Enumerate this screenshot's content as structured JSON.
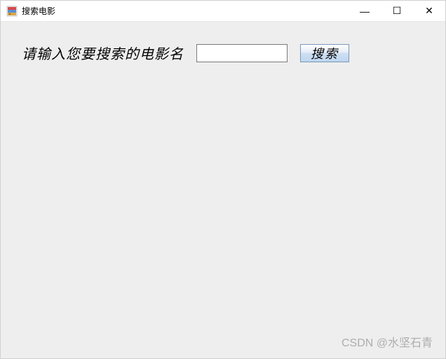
{
  "window": {
    "title": "搜索电影"
  },
  "controls": {
    "minimize": "—",
    "maximize": "☐",
    "close": "✕"
  },
  "search": {
    "label": "请输入您要搜索的电影名",
    "value": "",
    "button": "搜索"
  },
  "watermark": "CSDN @水坚石青"
}
